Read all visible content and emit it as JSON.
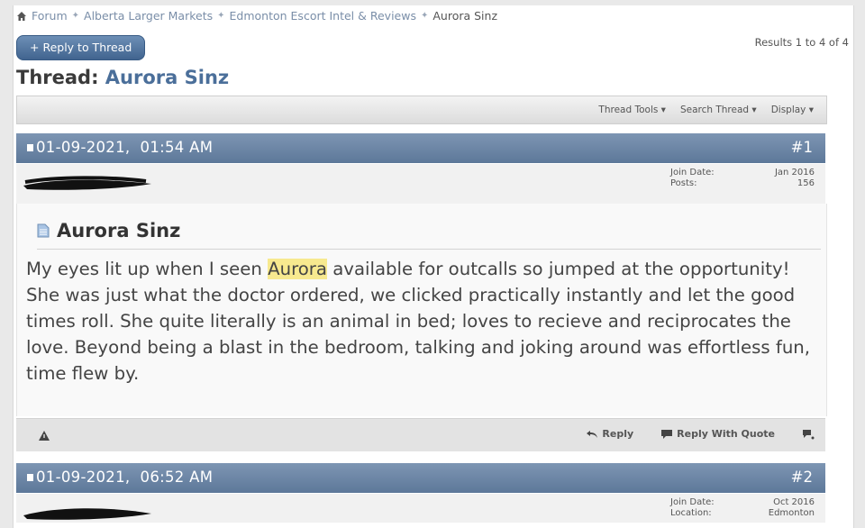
{
  "breadcrumb": {
    "items": [
      "Forum",
      "Alberta Larger Markets",
      "Edmonton Escort Intel & Reviews"
    ],
    "current": "Aurora Sinz"
  },
  "reply_thread_label": "+ Reply to Thread",
  "results_text": "Results 1 to 4 of 4",
  "thread": {
    "prefix": "Thread:",
    "name": "Aurora Sinz"
  },
  "toolbar": {
    "thread_tools": "Thread Tools ▾",
    "search_thread": "Search Thread ▾",
    "display": "Display ▾"
  },
  "posts": [
    {
      "date": "01-09-2021,",
      "time": "01:54 AM",
      "number": "#1",
      "user_info": [
        {
          "label": "Join Date:",
          "value": "Jan 2016"
        },
        {
          "label": "Posts:",
          "value": "156"
        }
      ],
      "title": "Aurora Sinz",
      "message_before": "My eyes lit up when I seen ",
      "message_highlight": "Aurora",
      "message_after": " available for outcalls so jumped at the opportunity! She was just what the doctor ordered, we clicked practically instantly and let the good times roll. She quite literally is an animal in bed; loves to recieve and reciprocates the love. Beyond being a blast in the bedroom, talking and joking around was effortless fun, time flew by.",
      "actions": {
        "reply": "Reply",
        "reply_with_quote": "Reply With Quote"
      }
    },
    {
      "date": "01-09-2021,",
      "time": "06:52 AM",
      "number": "#2",
      "user_info": [
        {
          "label": "Join Date:",
          "value": "Oct 2016"
        },
        {
          "label": "Location:",
          "value": "Edmonton"
        }
      ]
    }
  ],
  "colors": {
    "header_blue": "#6a84a6",
    "link_blue": "#4b6f9a",
    "highlight": "#f7e98f"
  }
}
